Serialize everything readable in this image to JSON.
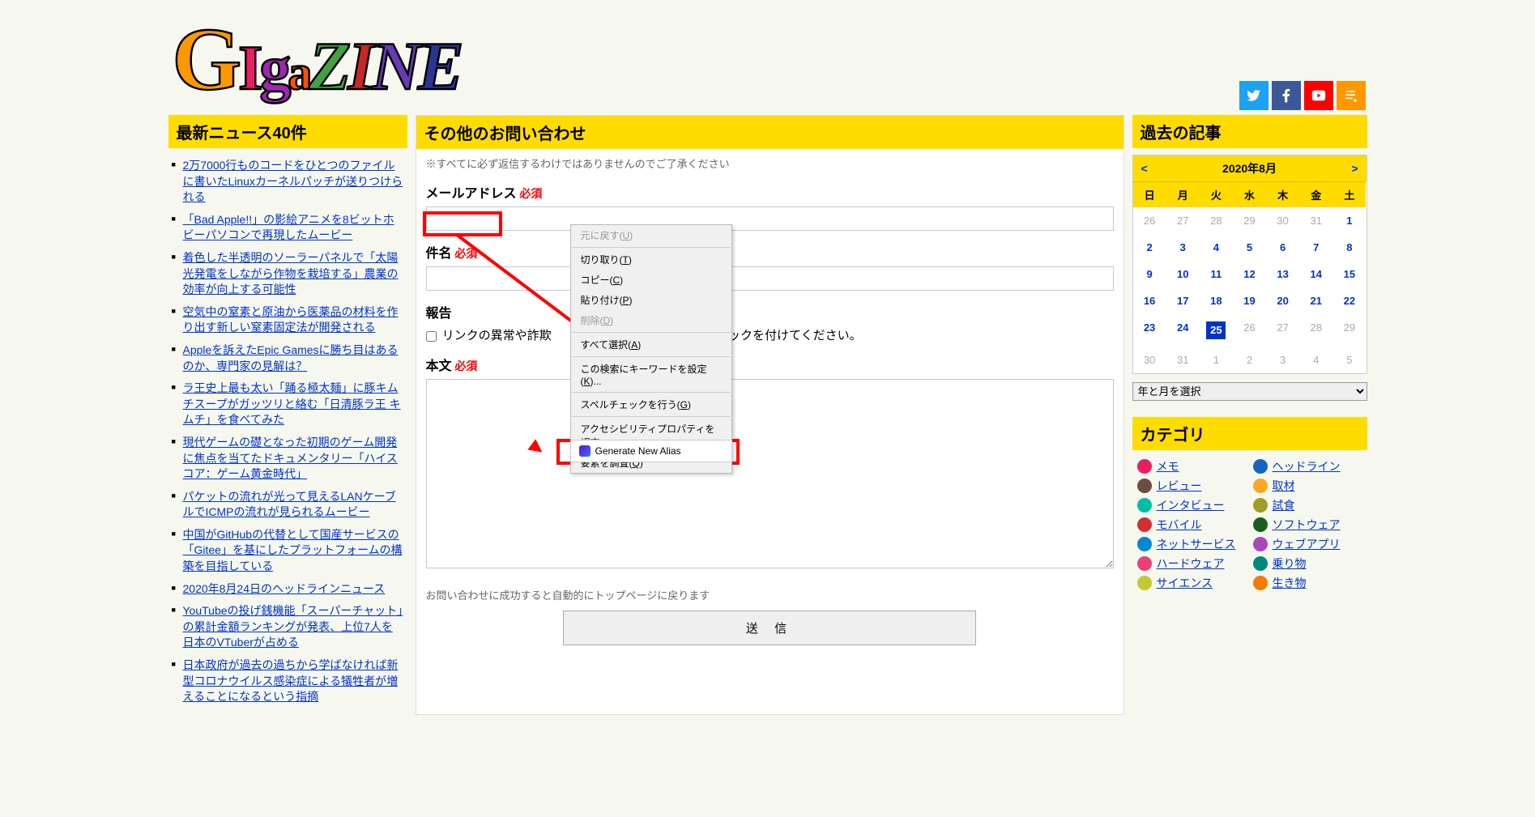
{
  "header": {
    "logo": "GIgaZINE"
  },
  "sidebar_left": {
    "title": "最新ニュース40件",
    "items": [
      "2万7000行ものコードをひとつのファイルに書いたLinuxカーネルパッチが送りつけられる",
      "「Bad Apple!!」の影絵アニメを8ビットホビーパソコンで再現したムービー",
      "着色した半透明のソーラーパネルで「太陽光発電をしながら作物を栽培する」農業の効率が向上する可能性",
      "空気中の窒素と原油から医薬品の材料を作り出す新しい窒素固定法が開発される",
      "Appleを訴えたEpic Gamesに勝ち目はあるのか、専門家の見解は？",
      "ラ王史上最も太い「踊る極太麺」に豚キムチスープがガッツリと絡む「日清豚ラ王 キムチ」を食べてみた",
      "現代ゲームの礎となった初期のゲーム開発に焦点を当てたドキュメンタリー「ハイスコア：ゲーム黄金時代」",
      "パケットの流れが光って見えるLANケーブルでICMPの流れが見られるムービー",
      "中国がGitHubの代替として国産サービスの「Gitee」を基にしたプラットフォームの構築を目指している",
      "2020年8月24日のヘッドラインニュース",
      "YouTubeの投げ銭機能「スーパーチャット」の累計金額ランキングが発表、上位7人を日本のVTuberが占める",
      "日本政府が過去の過ちから学ばなければ新型コロナウイルス感染症による犠牲者が増えることになるという指摘"
    ]
  },
  "form": {
    "title": "その他のお問い合わせ",
    "disclaimer": "※すべてに必ず返信するわけではありませんのでご了承ください",
    "email_label": "メールアドレス",
    "subject_label": "件名",
    "required": "必須",
    "report_label": "報告",
    "checkbox_text_prefix": "リンクの異常や詐欺",
    "checkbox_text_suffix": "ェックを付けてください。",
    "body_label": "本文",
    "submit_note": "お問い合わせに成功すると自動的にトップページに戻ります",
    "submit": "送 信"
  },
  "context_menu": {
    "undo": "元に戻す(U)",
    "cut": "切り取り(T)",
    "copy": "コピー(C)",
    "paste": "貼り付け(P)",
    "delete": "削除(D)",
    "select_all": "すべて選択(A)",
    "search_keyword": "この検索にキーワードを設定(K)...",
    "spellcheck": "スペルチェックを行う(G)",
    "accessibility": "アクセシビリティプロパティを調査",
    "inspect": "要素を調査(Q)",
    "generate": "Generate New Alias"
  },
  "calendar": {
    "title": "過去の記事",
    "month_label": "2020年8月",
    "prev": "<",
    "next": ">",
    "dow": [
      "日",
      "月",
      "火",
      "水",
      "木",
      "金",
      "土"
    ],
    "prev_month": [
      26,
      27,
      28,
      29,
      30,
      31
    ],
    "days": [
      1,
      2,
      3,
      4,
      5,
      6,
      7,
      8,
      9,
      10,
      11,
      12,
      13,
      14,
      15,
      16,
      17,
      18,
      19,
      20,
      21,
      22,
      23,
      24,
      25,
      26,
      27,
      28,
      29,
      30,
      31
    ],
    "today": 25,
    "last_active": 25,
    "next_month": [
      1,
      2,
      3,
      4,
      5
    ],
    "select_placeholder": "年と月を選択"
  },
  "categories": {
    "title": "カテゴリ",
    "items": [
      {
        "label": "メモ",
        "color": "#e91e63"
      },
      {
        "label": "ヘッドライン",
        "color": "#1565c0"
      },
      {
        "label": "レビュー",
        "color": "#6d4c41"
      },
      {
        "label": "取材",
        "color": "#f9a825"
      },
      {
        "label": "インタビュー",
        "color": "#00bfa5"
      },
      {
        "label": "試食",
        "color": "#9e9d24"
      },
      {
        "label": "モバイル",
        "color": "#d32f2f"
      },
      {
        "label": "ソフトウェア",
        "color": "#1b5e20"
      },
      {
        "label": "ネットサービス",
        "color": "#0288d1"
      },
      {
        "label": "ウェブアプリ",
        "color": "#ab47bc"
      },
      {
        "label": "ハードウェア",
        "color": "#ec407a"
      },
      {
        "label": "乗り物",
        "color": "#00897b"
      },
      {
        "label": "サイエンス",
        "color": "#c0ca33"
      },
      {
        "label": "生き物",
        "color": "#f57c00"
      }
    ]
  }
}
